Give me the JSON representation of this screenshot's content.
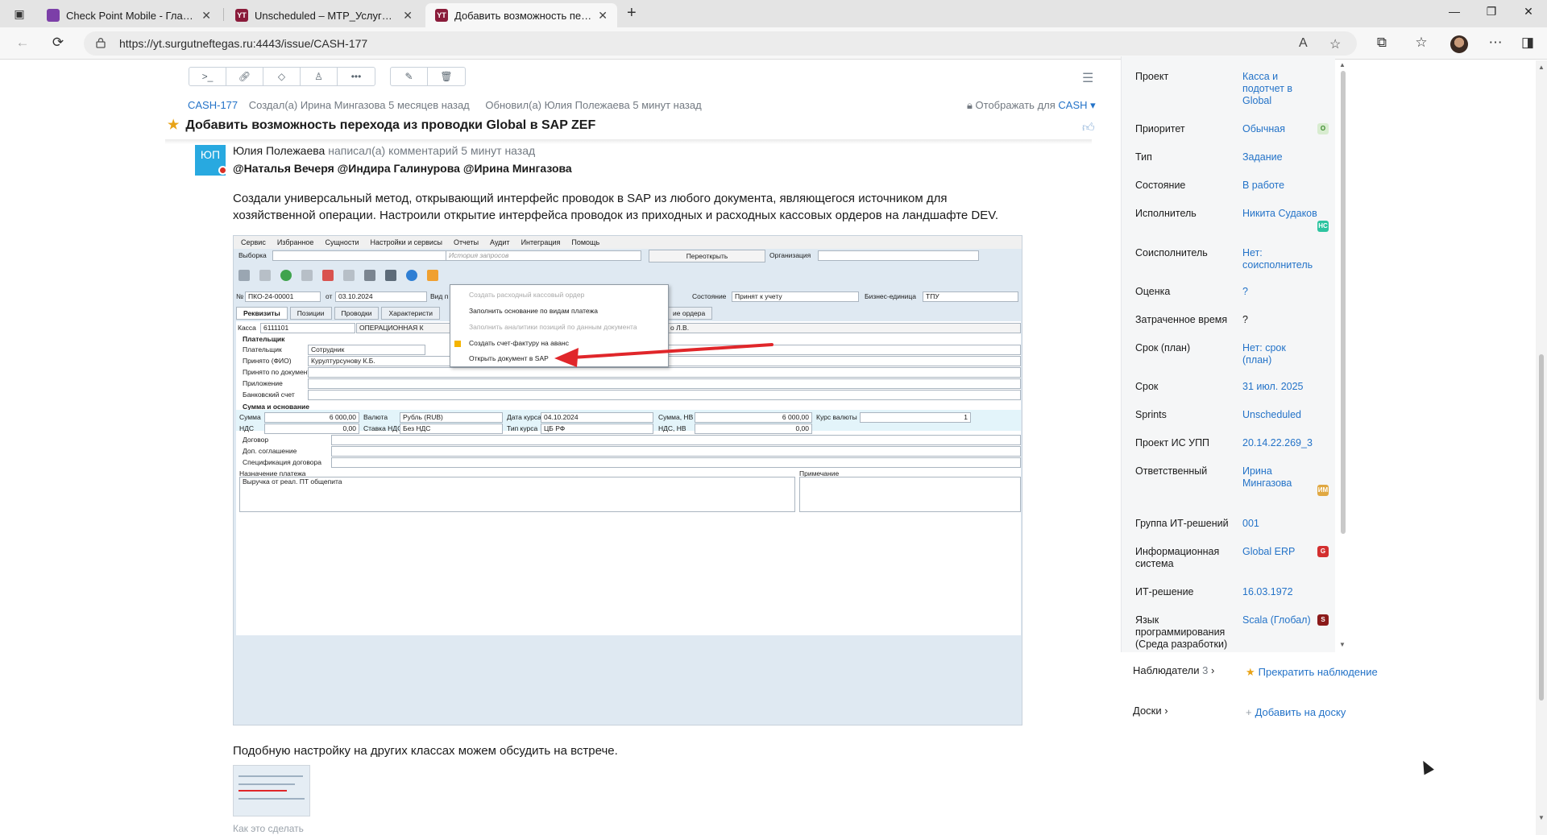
{
  "browser": {
    "tabs": [
      {
        "title": "Check Point Mobile - Главная",
        "color": "#7c3fa8",
        "active": false
      },
      {
        "title": "Unscheduled – МТР_Услуги стор",
        "color": "#8a1b3a",
        "active": false
      },
      {
        "title": "Добавить возможность переход",
        "color": "#8a1b3a",
        "active": true
      }
    ],
    "url": "https://yt.surgutneftegas.ru:4443/issue/CASH-177"
  },
  "issue": {
    "id": "CASH-177",
    "created": "Создал(а) Ирина Мингазова 5 месяцев назад",
    "updated": "Обновил(а) Юлия Полежаева 5 минут назад",
    "visible_for_label": "Отображать для",
    "visible_for_value": "CASH ▾",
    "title": "Добавить возможность перехода из проводки Global в SAP ZEF"
  },
  "comment": {
    "avatar_initials": "ЮП",
    "author": "Юлия Полежаева",
    "meta": "написал(а) комментарий 5 минут назад",
    "mentions": "@Наталья Вечеря @Индира Галинурова @Ирина Мингазова",
    "text": "Создали универсальный метод, открывающий интерфейс проводок в SAP из любого документа, являющегося источником для хозяйственной операции. Настроили открытие интерфейса проводок из приходных и расходных кассовых ордеров на ландшафте DEV.",
    "after_text": "Подобную настройку на других классах можем обсудить на встрече.",
    "cut_line": "Как это сделать"
  },
  "sap": {
    "menu": [
      "Сервис",
      "Избранное",
      "Сущности",
      "Настройки и сервисы",
      "Отчеты",
      "Аудит",
      "Интеграция",
      "Помощь"
    ],
    "vyborka_label": "Выборка",
    "history_placeholder": "История запросов",
    "reopen_button": "Переоткрыть",
    "org_label": "Организация",
    "no_label": "№",
    "doc_no": "ПКО-24-00001",
    "from_label": "от",
    "doc_date": "03.10.2024",
    "vid_label": "Вид п",
    "state_label": "Состояние",
    "state_value": "Принят к учету",
    "bu_label": "Бизнес-единица",
    "bu_value": "ТПУ",
    "tabs": [
      "Реквизиты",
      "Позиции",
      "Проводки",
      "Характеристи",
      "ие ордера"
    ],
    "kassa_label": "Касса",
    "kassa_value": "6111101",
    "kassa_desc": "ОПЕРАЦИОННАЯ К",
    "kassa_right": "о Л.В.",
    "payer_group": "Плательщик",
    "payer_label": "Плательщик",
    "payer_value": "Сотрудник",
    "accepted_label": "Принято (ФИО)",
    "accepted_value": "Курултурсунову К.Б.",
    "by_doc_label": "Принято по документу",
    "attach_label": "Приложение",
    "bank_label": "Банковский счет",
    "sum_group": "Сумма и основание",
    "sum_label": "Сумма",
    "sum_value": "6 000,00",
    "currency_label": "Валюта",
    "currency_value": "Рубль (RUB)",
    "rate_date_label": "Дата курса",
    "rate_date_value": "04.10.2024",
    "sum_nv_label": "Сумма, НВ",
    "sum_nv_value": "6 000,00",
    "rate_label": "Курс валюты",
    "rate_value": "1",
    "vat_label": "НДС",
    "vat_value": "0,00",
    "vat_rate_label": "Ставка НДС",
    "vat_rate_value": "Без НДС",
    "rate_type_label": "Тип курса",
    "rate_type_value": "ЦБ РФ",
    "vat_nv_label": "НДС, НВ",
    "vat_nv_value": "0,00",
    "contract_label": "Договор",
    "addendum_label": "Доп. соглашение",
    "spec_label": "Спецификация договора",
    "purpose_label": "Назначение платежа",
    "purpose_value": "Выручка от реал. ПТ общепита",
    "note_label": "Примечание",
    "popup": [
      {
        "label": "Создать расходный кассовый ордер",
        "disabled": true
      },
      {
        "label": "Заполнить основание по видам платежа",
        "disabled": false
      },
      {
        "label": "Заполнить аналитики позиций по данным документа",
        "disabled": true
      },
      {
        "label": "Создать счет-фактуру на аванс",
        "disabled": false
      },
      {
        "label": "Открыть документ в SAP",
        "disabled": false
      }
    ]
  },
  "sidebar": {
    "fields": [
      {
        "key": "Проект",
        "value": "Касса и подотчет в Global",
        "link": true
      },
      {
        "key": "Приоритет",
        "value": "Обычная",
        "link": true,
        "badge": "O",
        "badge_color": "#d8ecd0",
        "badge_text_color": "#3a8a2a"
      },
      {
        "key": "Тип",
        "value": "Задание",
        "link": true
      },
      {
        "key": "Состояние",
        "value": "В работе",
        "link": true
      },
      {
        "key": "Исполнитель",
        "value": "Никита Судаков",
        "link": true,
        "badge": "НС",
        "badge_color": "#2ec4a0"
      },
      {
        "key": "Соисполнитель",
        "value": "Нет: соисполнитель",
        "link": true
      },
      {
        "key": "Оценка",
        "value": "?",
        "link": true
      },
      {
        "key": "Затраченное время",
        "value": "?",
        "link": false
      },
      {
        "key": "Срок (план)",
        "value": "Нет: срок (план)",
        "link": true
      },
      {
        "key": "Срок",
        "value": "31 июл. 2025",
        "link": true
      },
      {
        "key": "Sprints",
        "value": "Unscheduled",
        "link": true
      },
      {
        "key": "Проект ИС УПП",
        "value": "20.14.22.269_3",
        "link": true
      },
      {
        "key": "Ответственный",
        "value": "Ирина Мингазова",
        "link": true,
        "badge": "ИМ",
        "badge_color": "#e0a842"
      },
      {
        "key": "Группа ИТ-решений",
        "value": "001",
        "link": true
      },
      {
        "key": "Информационная система",
        "value": "Global ERP",
        "link": true,
        "badge": "G",
        "badge_color": "#d32f2f"
      },
      {
        "key": "ИТ-решение",
        "value": "16.03.1972",
        "link": true
      },
      {
        "key": "Язык программирования (Среда разработки)",
        "value": "Scala (Глобал)",
        "link": true,
        "badge": "S",
        "badge_color": "#8b1a1a"
      }
    ],
    "watchers_label": "Наблюдатели",
    "watchers_count": "3",
    "stop_watching": "Прекратить наблюдение",
    "boards_label": "Доски",
    "add_to_board": "Добавить на доску"
  }
}
